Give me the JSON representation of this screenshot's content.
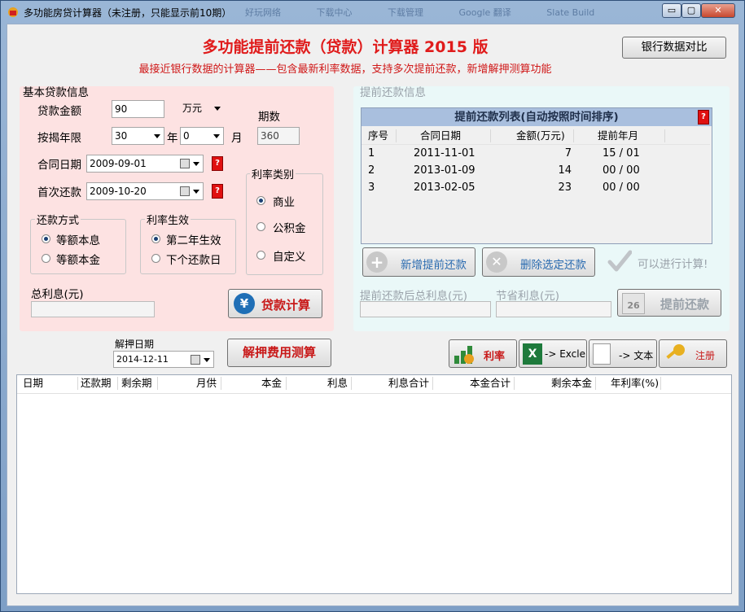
{
  "window": {
    "title": "多功能房贷计算器（未注册，只能显示前10期）",
    "ghost_tabs": [
      "好玩网络",
      "下载中心",
      "下载管理",
      "Google 翻译",
      "Slate Build"
    ],
    "min": "▭",
    "max": "▢",
    "close": "✕"
  },
  "header": {
    "title": "多功能提前还款（贷款）计算器 2015 版",
    "subtitle": "最接近银行数据的计算器——包含最新利率数据，支持多次提前还款，新增解押测算功能",
    "bank_compare_button": "银行数据对比"
  },
  "basic": {
    "group_title": "基本贷款信息",
    "amount_label": "贷款金额",
    "amount_value": "90",
    "amount_unit": "万元",
    "years_label": "按揭年限",
    "years_value": "30",
    "year_unit": "年",
    "months_value": "0",
    "month_unit": "月",
    "periods_label": "期数",
    "periods_value": "360",
    "contract_date_label": "合同日期",
    "contract_date_value": "2009-09-01",
    "first_repay_label": "首次还款",
    "first_repay_value": "2009-10-20",
    "help": "?",
    "repay_method_title": "还款方式",
    "repay_method_options": [
      "等额本息",
      "等额本金"
    ],
    "rate_effect_title": "利率生效",
    "rate_effect_options": [
      "第二年生效",
      "下个还款日"
    ],
    "rate_type_title": "利率类别",
    "rate_type_options": [
      "商业",
      "公积金",
      "自定义"
    ],
    "total_interest_label": "总利息(元)",
    "total_interest_value": "",
    "calc_button": "贷款计算",
    "calc_icon": "¥"
  },
  "prepay": {
    "group_title": "提前还款信息",
    "list_title": "提前还款列表(自动按照时间排序)",
    "help": "?",
    "columns": [
      "序号",
      "合同日期",
      "金额(万元)",
      "提前年月"
    ],
    "rows": [
      [
        "1",
        "2011-11-01",
        "7",
        "15 / 01"
      ],
      [
        "2",
        "2013-01-09",
        "14",
        "00 / 00"
      ],
      [
        "3",
        "2013-02-05",
        "23",
        "00 / 00"
      ]
    ],
    "add_button": "新增提前还款",
    "delete_button": "删除选定还款",
    "can_calc_text": "可以进行计算!",
    "after_interest_label": "提前还款后总利息(元)",
    "saved_interest_label": "节省利息(元)",
    "prepay_button": "提前还款",
    "calendar_day": "26"
  },
  "toolbar": {
    "release_date_label": "解押日期",
    "release_date_value": "2014-12-11",
    "release_cost_button": "解押费用测算",
    "rate_button": "利率",
    "excel_button": "-> Excle",
    "text_button": "-> 文本",
    "register_button": "注册"
  },
  "schedule": {
    "columns": [
      "日期",
      "还款期",
      "剩余期",
      "月供",
      "本金",
      "利息",
      "利息合计",
      "本金合计",
      "剩余本金",
      "年利率(%)"
    ],
    "rows": []
  },
  "colors": {
    "accent_red": "#e01b1b",
    "left_panel_bg": "#fde2e2",
    "right_panel_bg": "#eaf8f8",
    "list_header_bg": "#a9bfde"
  }
}
